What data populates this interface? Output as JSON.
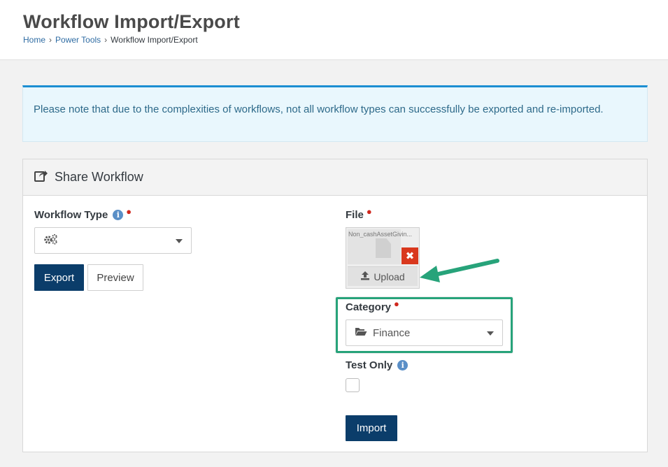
{
  "page": {
    "title": "Workflow Import/Export",
    "breadcrumb": [
      {
        "label": "Home",
        "link": true
      },
      {
        "label": "Power Tools",
        "link": true
      },
      {
        "label": "Workflow Import/Export",
        "link": false
      }
    ]
  },
  "alert": {
    "text": "Please note that due to the complexities of workflows, not all workflow types can successfully be exported and re-imported."
  },
  "panel": {
    "title": "Share Workflow",
    "icon": "share-icon"
  },
  "export_form": {
    "workflow_type_label": "Workflow Type",
    "workflow_type_value": "",
    "workflow_type_icon": "gears-icon",
    "export_label": "Export",
    "preview_label": "Preview"
  },
  "import_form": {
    "file_label": "File",
    "file_name": "Non_cashAssetGivin...",
    "upload_label": "Upload",
    "category_label": "Category",
    "category_value": "Finance",
    "category_icon": "folder-open-icon",
    "test_only_label": "Test Only",
    "test_only_checked": false,
    "import_label": "Import"
  },
  "colors": {
    "primary": "#0b3d6a",
    "alert_border": "#1c8ed2",
    "alert_bg": "#e9f7fd",
    "required": "#d0281e",
    "annotation": "#27a37a",
    "delete": "#d9381e"
  }
}
